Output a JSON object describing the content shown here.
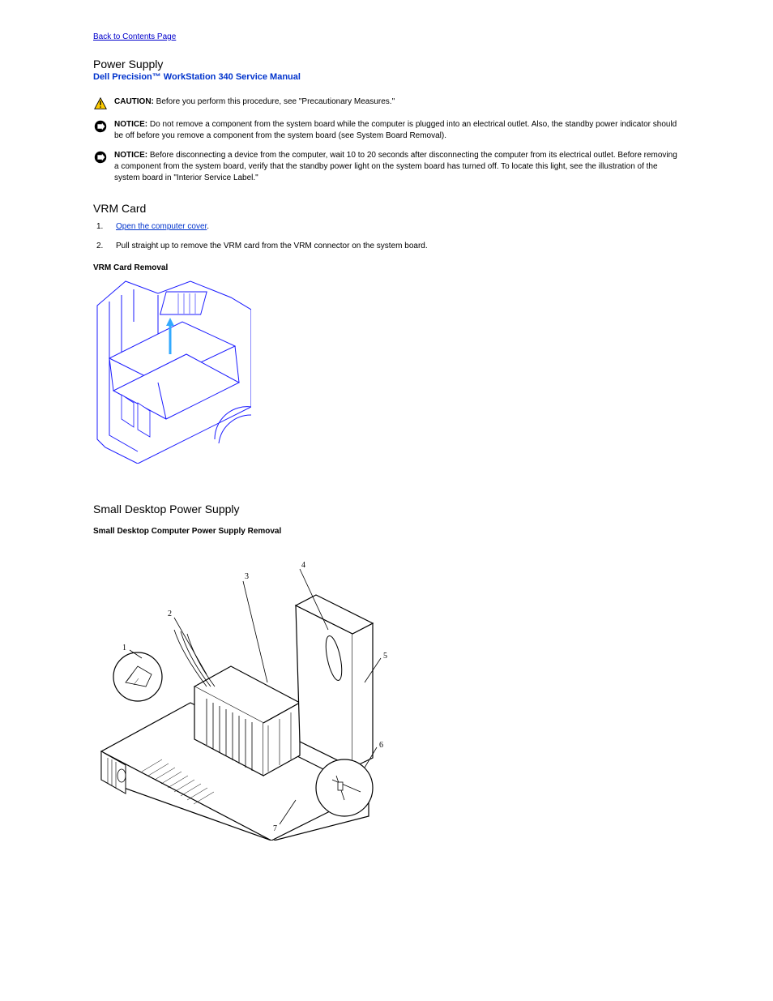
{
  "nav": {
    "back": "Back to Contents Page"
  },
  "header": {
    "title": "Power Supply",
    "manual": "Dell Precision™ WorkStation 340 Service Manual"
  },
  "callouts": {
    "caution_label": "CAUTION:",
    "caution_text": " Before you perform this procedure, see \"Precautionary Measures.\"",
    "notice1_label": "NOTICE:",
    "notice1_text": " Do not remove a component from the system board while the computer is plugged into an electrical outlet. Also, the standby power indicator should be off before you remove a component from the system board (see System Board Removal).",
    "notice2_label": "NOTICE:",
    "notice2_text": " Before disconnecting a device from the computer, wait 10 to 20 seconds after disconnecting the computer from its electrical outlet. Before removing a component from the system board, verify that the standby power light on the system board has turned off. To locate this light, see the illustration of the system board in \"Interior Service Label.\""
  },
  "sections": {
    "vrm": {
      "title": "VRM Card",
      "steps": [
        {
          "n": "1.",
          "pre": "",
          "link": "Open the computer cover",
          "post": "."
        },
        {
          "n": "2.",
          "text": "Pull straight up to remove the VRM card from the VRM connector on the system board."
        }
      ],
      "figure": "VRM Card Removal"
    },
    "sdps": {
      "title": "Small Desktop Power Supply",
      "figure": "Small Desktop Computer Power Supply Removal"
    }
  }
}
